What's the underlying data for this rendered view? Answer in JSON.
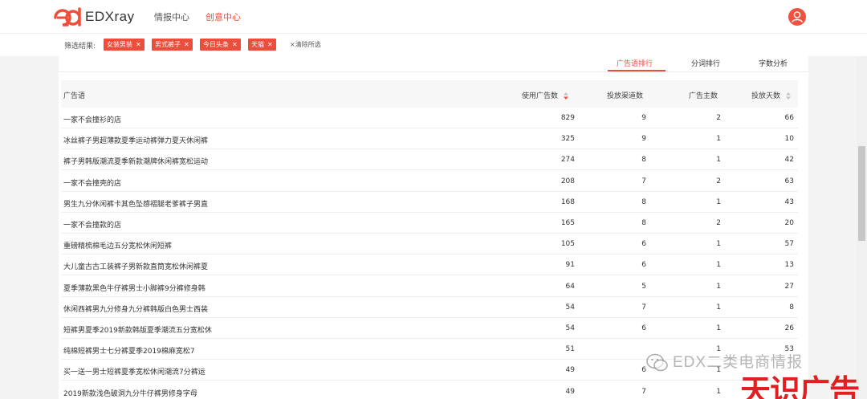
{
  "app": {
    "logo_text": "EDXray"
  },
  "nav": {
    "items": [
      {
        "label": "情报中心"
      },
      {
        "label": "创意中心"
      }
    ]
  },
  "filter": {
    "label": "筛选结果:",
    "chips": [
      {
        "label": "女装男装"
      },
      {
        "label": "男式裤子"
      },
      {
        "label": "今日头条"
      },
      {
        "label": "天猫"
      }
    ],
    "clear_label": "清除所选"
  },
  "tabs": [
    {
      "label": "广告语排行"
    },
    {
      "label": "分词排行"
    },
    {
      "label": "字数分析"
    }
  ],
  "table": {
    "columns": [
      {
        "label": "广告语"
      },
      {
        "label": "使用广告数"
      },
      {
        "label": "投放渠道数"
      },
      {
        "label": "广告主数"
      },
      {
        "label": "投放天数"
      }
    ],
    "rows": [
      {
        "slogan": "一家不会撞衫的店",
        "ads": "829",
        "channels": "9",
        "advertisers": "2",
        "days": "66"
      },
      {
        "slogan": "冰丝裤子男超薄款夏季运动裤弹力夏天休闲裤",
        "ads": "325",
        "channels": "9",
        "advertisers": "1",
        "days": "10"
      },
      {
        "slogan": "裤子男韩版潮流夏季新款潮牌休闲裤宽松运动",
        "ads": "274",
        "channels": "8",
        "advertisers": "1",
        "days": "42"
      },
      {
        "slogan": "一家不会撞壳的店",
        "ads": "208",
        "channels": "7",
        "advertisers": "2",
        "days": "63"
      },
      {
        "slogan": "男生九分休闲裤卡其色坠感褶腿老爹裤子男直",
        "ads": "168",
        "channels": "8",
        "advertisers": "1",
        "days": "43"
      },
      {
        "slogan": "一家不会撞款的店",
        "ads": "165",
        "channels": "8",
        "advertisers": "2",
        "days": "20"
      },
      {
        "slogan": "重磅精梳棉毛边五分宽松休闲短裤",
        "ads": "105",
        "channels": "6",
        "advertisers": "1",
        "days": "57"
      },
      {
        "slogan": "大儿童古古工装裤子男新款直筒宽松休闲裤夏",
        "ads": "91",
        "channels": "6",
        "advertisers": "1",
        "days": "13"
      },
      {
        "slogan": "夏季薄款黑色牛仔裤男士小脚裤9分裤修身韩",
        "ads": "64",
        "channels": "5",
        "advertisers": "1",
        "days": "27"
      },
      {
        "slogan": "休闲西裤男九分修身九分裤韩版白色男士西装",
        "ads": "54",
        "channels": "7",
        "advertisers": "1",
        "days": "8"
      },
      {
        "slogan": "短裤男夏季2019新款韩版夏季潮流五分宽松休",
        "ads": "54",
        "channels": "6",
        "advertisers": "1",
        "days": "26"
      },
      {
        "slogan": "纯棉短裤男士七分裤夏季2019棉麻宽松7",
        "ads": "51",
        "channels": "",
        "advertisers": "1",
        "days": "53"
      },
      {
        "slogan": "买一送一男士短裤夏季宽松休闲潮流7分裤运",
        "ads": "49",
        "channels": "6",
        "advertisers": "1",
        "days": ""
      },
      {
        "slogan": "2019新款浅色破洞九分牛仔裤男修身字母",
        "ads": "49",
        "channels": "7",
        "advertisers": "1",
        "days": ""
      }
    ]
  },
  "watermark": {
    "line1": "EDX二类电商情报",
    "line2": "天识广告"
  },
  "colors": {
    "accent": "#ef4d3c",
    "watermark_red": "#e02020"
  },
  "icons": {
    "logo": "edx-logo-icon",
    "avatar": "user-avatar-icon",
    "sort": "sort-icon",
    "close": "close-icon",
    "wechat": "wechat-icon"
  }
}
